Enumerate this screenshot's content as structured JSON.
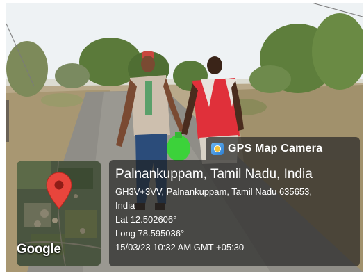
{
  "overlay": {
    "app_name": "GPS Map Camera",
    "place_title": "Palnankuppam, Tamil Nadu, India",
    "address_line": "GH3V+3VV, Palnankuppam, Tamil Nadu 635653,",
    "country_line": "India",
    "lat": "Lat 12.502606°",
    "long": "Long 78.595036°",
    "datetime": "15/03/23 10:32 AM GMT +05:30"
  },
  "map": {
    "attribution": "Google",
    "pin_color": "#e8453c"
  },
  "colors": {
    "sky": "#f2f5f6",
    "road": "#8e8c86",
    "foliage": "#5f7d3e",
    "red_shirt": "#e0303a"
  }
}
